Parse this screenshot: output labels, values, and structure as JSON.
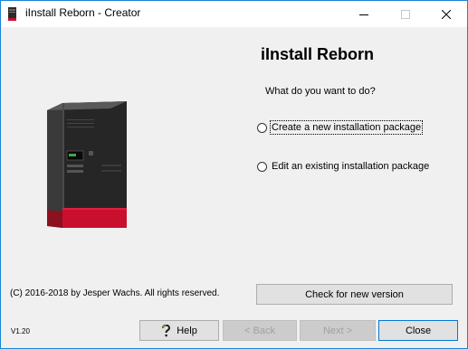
{
  "window": {
    "title": "iInstall Reborn - Creator"
  },
  "titlebar": {
    "minimize_icon": "minimize-icon",
    "maximize_icon": "maximize-icon",
    "close_icon": "close-icon"
  },
  "main": {
    "heading": "iInstall Reborn",
    "prompt": "What do you want to do?",
    "options": [
      {
        "label": "Create a new installation package",
        "selected": false
      },
      {
        "label": "Edit an existing installation package",
        "selected": false
      }
    ],
    "illustration_icon": "server-tower-icon"
  },
  "footer": {
    "copyright": "(C) 2016-2018 by Jesper Wachs. All rights reserved.",
    "check_button": "Check for new version",
    "version": "V1.20"
  },
  "wizard_buttons": {
    "help": "Help",
    "back": "< Back",
    "next": "Next >",
    "close": "Close"
  },
  "colors": {
    "window_border": "#1883d7",
    "client_background": "#f0f0f0",
    "button_face": "#e1e1e1",
    "disabled_text": "#a0a0a0",
    "server_accent": "#c8102e"
  }
}
